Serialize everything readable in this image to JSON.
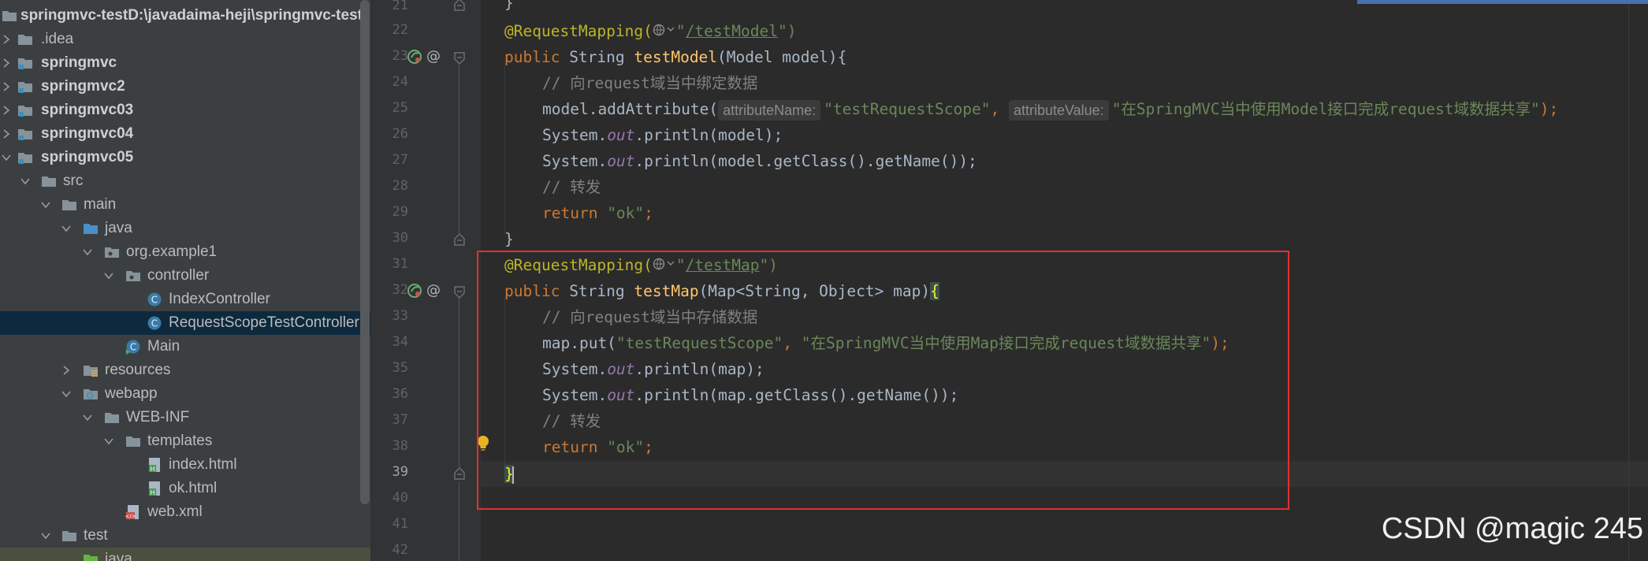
{
  "project": {
    "root_name": "springmvc-test",
    "root_path": "D:\\javadaima-heji\\springmvc-test",
    "items": [
      {
        "label": "springmvc-test",
        "icon": "folder-icon"
      },
      {
        "label": ".idea",
        "icon": "folder-icon"
      },
      {
        "label": "springmvc",
        "icon": "module-folder-icon"
      },
      {
        "label": "springmvc2",
        "icon": "module-folder-icon"
      },
      {
        "label": "springmvc03",
        "icon": "module-folder-icon"
      },
      {
        "label": "springmvc04",
        "icon": "module-folder-icon"
      },
      {
        "label": "springmvc05",
        "icon": "module-folder-icon"
      },
      {
        "label": "src",
        "icon": "folder-icon"
      },
      {
        "label": "main",
        "icon": "folder-icon"
      },
      {
        "label": "java",
        "icon": "source-folder-icon"
      },
      {
        "label": "org.example1",
        "icon": "package-icon"
      },
      {
        "label": "controller",
        "icon": "package-icon"
      },
      {
        "label": "IndexController",
        "icon": "java-class-icon"
      },
      {
        "label": "RequestScopeTestController",
        "icon": "java-class-icon"
      },
      {
        "label": "Main",
        "icon": "java-main-class-icon"
      },
      {
        "label": "resources",
        "icon": "resources-folder-icon"
      },
      {
        "label": "webapp",
        "icon": "web-folder-icon"
      },
      {
        "label": "WEB-INF",
        "icon": "folder-icon"
      },
      {
        "label": "templates",
        "icon": "folder-icon"
      },
      {
        "label": "index.html",
        "icon": "html-file-icon"
      },
      {
        "label": "ok.html",
        "icon": "html-file-icon"
      },
      {
        "label": "web.xml",
        "icon": "xml-file-icon"
      },
      {
        "label": "test",
        "icon": "folder-icon"
      },
      {
        "label": "java",
        "icon": "test-source-folder-icon"
      }
    ]
  },
  "editor": {
    "line_numbers": [
      "21",
      "22",
      "23",
      "24",
      "25",
      "26",
      "27",
      "28",
      "29",
      "30",
      "31",
      "32",
      "33",
      "34",
      "35",
      "36",
      "37",
      "38",
      "39",
      "40",
      "41",
      "42"
    ],
    "current_line": "39",
    "code": {
      "l21": "}",
      "l22_annotation": "@RequestMapping(",
      "l22_url": "/testModel",
      "l22_end": "\")",
      "l23_kw": "public",
      "l23_type": " String ",
      "l23_fn": "testModel",
      "l23_rest": "(Model model){",
      "l24": "// 向request域当中绑定数据",
      "l25_start": "model.addAttribute(",
      "l25_hint1": "attributeName:",
      "l25_str1": "\"testRequestScope\"",
      "l25_comma": ", ",
      "l25_hint2": "attributeValue:",
      "l25_str2": "\"在SpringMVC当中使用Model接口完成request域数据共享\"",
      "l25_end": ");",
      "l26_a": "System.",
      "l26_out": "out",
      "l26_b": ".println(model);",
      "l27_a": "System.",
      "l27_out": "out",
      "l27_b": ".println(model.getClass().getName());",
      "l28": "// 转发",
      "l29_kw": "return ",
      "l29_str": "\"ok\"",
      "l29_end": ";",
      "l30": "}",
      "l31_annotation": "@RequestMapping(",
      "l31_url": "/testMap",
      "l31_end": "\")",
      "l32_kw": "public",
      "l32_type": " String ",
      "l32_fn": "testMap",
      "l32_rest": "(Map<String, Object> map)",
      "l32_brace": "{",
      "l33": "// 向request域当中存储数据",
      "l34_a": "map.put(",
      "l34_str1": "\"testRequestScope\"",
      "l34_comma": ", ",
      "l34_str2": "\"在SpringMVC当中使用Map接口完成request域数据共享\"",
      "l34_end": ");",
      "l35_a": "System.",
      "l35_out": "out",
      "l35_b": ".println(map);",
      "l36_a": "System.",
      "l36_out": "out",
      "l36_b": ".println(map.getClass().getName());",
      "l37": "// 转发",
      "l38_kw": "return ",
      "l38_str": "\"ok\"",
      "l38_end": ";",
      "l39": "}"
    }
  },
  "watermark": "CSDN @magic 245",
  "colors": {
    "keyword": "#cc7832",
    "annotation": "#bbb529",
    "string": "#6a8759",
    "comment": "#808080",
    "method": "#ffc66d",
    "static_field": "#9876aa",
    "highlight_box": "#e23030"
  }
}
